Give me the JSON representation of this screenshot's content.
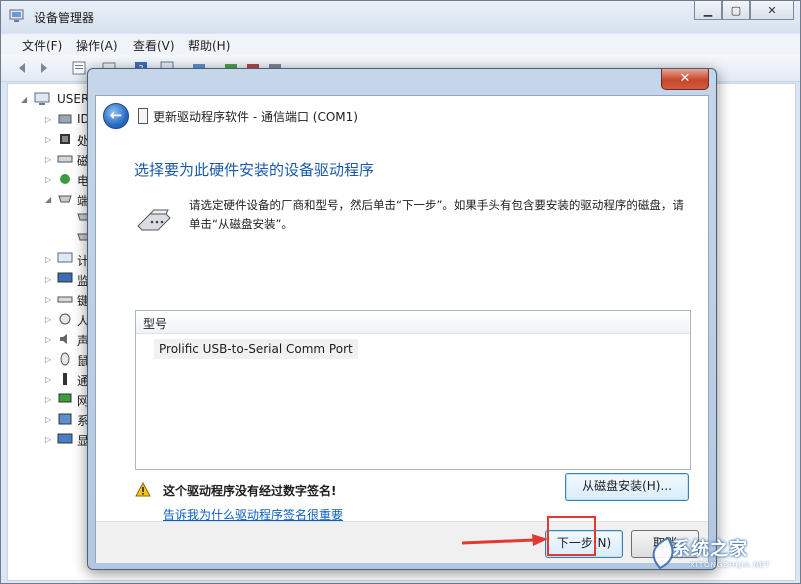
{
  "window": {
    "title": "设备管理器",
    "controls": {
      "minimize": "▁",
      "maximize": "▢",
      "close": "✕"
    }
  },
  "menu": [
    "文件(F)",
    "操作(A)",
    "查看(V)",
    "帮助(H)"
  ],
  "tree": {
    "root": "USER",
    "items": [
      "ID",
      "处",
      "磁",
      "电",
      "端",
      "计",
      "监",
      "键",
      "人",
      "声",
      "鼠",
      "通",
      "网",
      "系",
      "显"
    ]
  },
  "dialog": {
    "header_title": "更新驱动程序软件 - 通信端口 (COM1)",
    "heading": "选择要为此硬件安装的设备驱动程序",
    "description": "请选定硬件设备的厂商和型号，然后单击“下一步”。如果手头有包含要安装的驱动程序的磁盘，请单击“从磁盘安装”。",
    "list_header": "型号",
    "list_items": [
      "Prolific USB-to-Serial Comm Port"
    ],
    "warning": "这个驱动程序没有经过数字签名!",
    "link": "告诉我为什么驱动程序签名很重要",
    "have_disk_button": "从磁盘安装(H)...",
    "next_button": "下一步(N)",
    "cancel_button": "取消",
    "close": "✕",
    "back_glyph": "←"
  },
  "watermark": {
    "text": "系统之家",
    "sub": "XITONGZHIJIA.NET"
  },
  "colors": {
    "heading": "#1b5aa6",
    "link": "#0b5fc0",
    "highlight": "#e23a30"
  }
}
